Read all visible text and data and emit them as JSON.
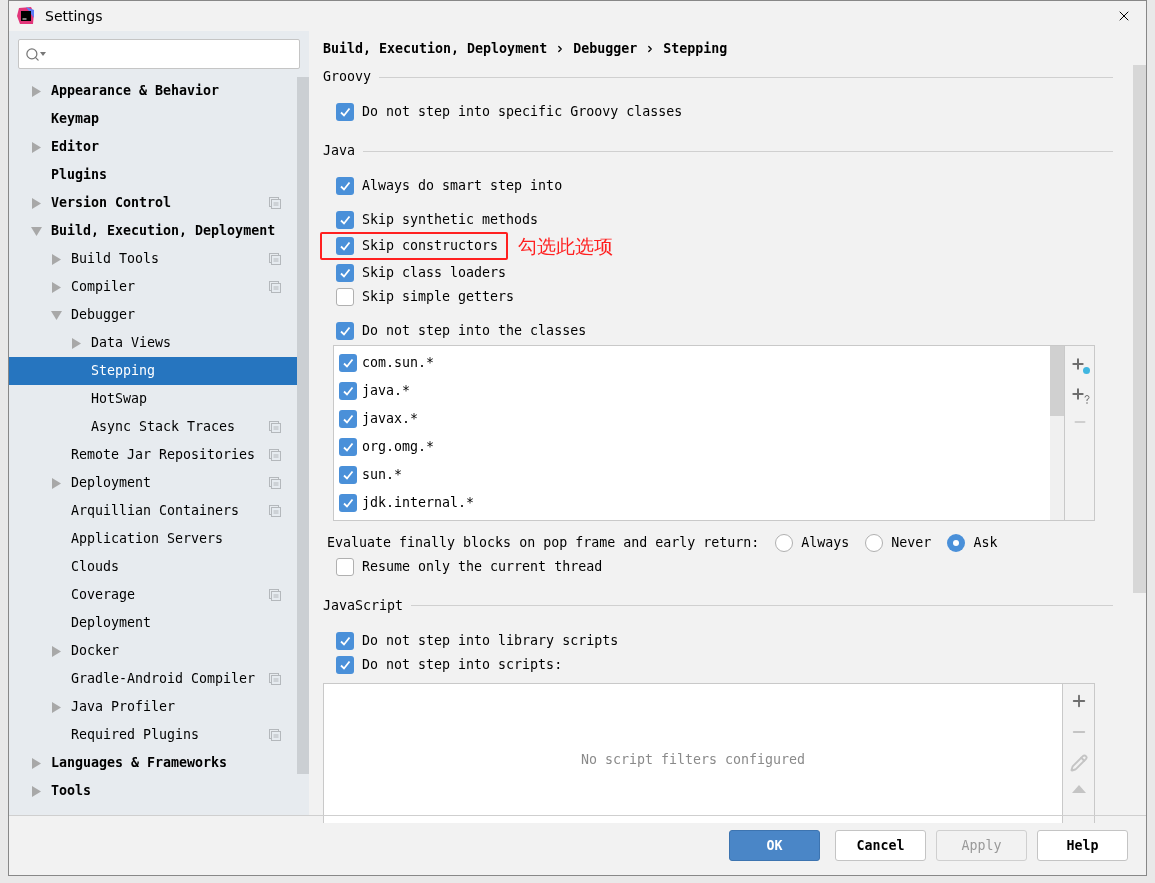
{
  "window": {
    "title": "Settings"
  },
  "sidebar": {
    "items": [
      {
        "label": "Appearance & Behavior",
        "kind": "branch",
        "expanded": false,
        "selected": false,
        "project_level": false
      },
      {
        "label": "Keymap",
        "kind": "leaf",
        "selected": false,
        "project_level": false
      },
      {
        "label": "Editor",
        "kind": "branch",
        "expanded": false,
        "selected": false,
        "project_level": false
      },
      {
        "label": "Plugins",
        "kind": "leaf",
        "selected": false,
        "project_level": false
      },
      {
        "label": "Version Control",
        "kind": "branch",
        "expanded": false,
        "selected": false,
        "project_level": true
      },
      {
        "label": "Build, Execution, Deployment",
        "kind": "branch",
        "expanded": true,
        "selected": false,
        "project_level": false,
        "children": [
          {
            "label": "Build Tools",
            "kind": "branch",
            "expanded": false,
            "selected": false,
            "project_level": true
          },
          {
            "label": "Compiler",
            "kind": "branch",
            "expanded": false,
            "selected": false,
            "project_level": true
          },
          {
            "label": "Debugger",
            "kind": "branch",
            "expanded": true,
            "selected": false,
            "project_level": false,
            "children": [
              {
                "label": "Data Views",
                "kind": "branch",
                "expanded": false,
                "selected": false,
                "project_level": false
              },
              {
                "label": "Stepping",
                "kind": "leaf",
                "selected": true,
                "project_level": false
              },
              {
                "label": "HotSwap",
                "kind": "leaf",
                "selected": false,
                "project_level": false
              },
              {
                "label": "Async Stack Traces",
                "kind": "leaf",
                "selected": false,
                "project_level": true
              }
            ]
          },
          {
            "label": "Remote Jar Repositories",
            "kind": "leaf",
            "selected": false,
            "project_level": true
          },
          {
            "label": "Deployment",
            "kind": "branch",
            "expanded": false,
            "selected": false,
            "project_level": true
          },
          {
            "label": "Arquillian Containers",
            "kind": "leaf",
            "selected": false,
            "project_level": true
          },
          {
            "label": "Application Servers",
            "kind": "leaf",
            "selected": false,
            "project_level": false
          },
          {
            "label": "Clouds",
            "kind": "leaf",
            "selected": false,
            "project_level": false
          },
          {
            "label": "Coverage",
            "kind": "leaf",
            "selected": false,
            "project_level": true
          },
          {
            "label": "Deployment",
            "kind": "leaf",
            "selected": false,
            "project_level": false
          },
          {
            "label": "Docker",
            "kind": "branch",
            "expanded": false,
            "selected": false,
            "project_level": false
          },
          {
            "label": "Gradle-Android Compiler",
            "kind": "leaf",
            "selected": false,
            "project_level": true
          },
          {
            "label": "Java Profiler",
            "kind": "branch",
            "expanded": false,
            "selected": false,
            "project_level": false
          },
          {
            "label": "Required Plugins",
            "kind": "leaf",
            "selected": false,
            "project_level": true
          }
        ]
      },
      {
        "label": "Languages & Frameworks",
        "kind": "branch",
        "expanded": false,
        "selected": false,
        "project_level": false
      },
      {
        "label": "Tools",
        "kind": "branch",
        "expanded": false,
        "selected": false,
        "project_level": false
      }
    ]
  },
  "breadcrumb": [
    "Build, Execution, Deployment",
    "Debugger",
    "Stepping"
  ],
  "sections": [
    {
      "title": "Groovy",
      "groups": [
        [
          {
            "kind": "checkbox",
            "label": "Do not step into specific Groovy classes",
            "checked": true
          }
        ]
      ]
    },
    {
      "title": "Java",
      "groups": [
        [
          {
            "kind": "checkbox",
            "label": "Always do smart step into",
            "checked": true
          }
        ],
        [
          {
            "kind": "checkbox",
            "label": "Skip synthetic methods",
            "checked": true
          },
          {
            "kind": "checkbox",
            "label": "Skip constructors",
            "checked": true,
            "annotation": "勾选此选项"
          },
          {
            "kind": "checkbox",
            "label": "Skip class loaders",
            "checked": true
          },
          {
            "kind": "checkbox",
            "label": "Skip simple getters",
            "checked": false
          }
        ],
        [
          {
            "kind": "checkbox",
            "label": "Do not step into the classes",
            "checked": true
          },
          {
            "kind": "class_list",
            "items": [
              {
                "label": "com.sun.*",
                "checked": true
              },
              {
                "label": "java.*",
                "checked": true
              },
              {
                "label": "javax.*",
                "checked": true
              },
              {
                "label": "org.omg.*",
                "checked": true
              },
              {
                "label": "sun.*",
                "checked": true
              },
              {
                "label": "jdk.internal.*",
                "checked": true
              }
            ]
          }
        ],
        [
          {
            "kind": "radio_group",
            "label": "Evaluate finally blocks on pop frame and early return:",
            "options": [
              {
                "label": "Always",
                "selected": false
              },
              {
                "label": "Never",
                "selected": false
              },
              {
                "label": "Ask",
                "selected": true
              }
            ]
          },
          {
            "kind": "checkbox",
            "label": "Resume only the current thread",
            "checked": false
          }
        ]
      ]
    },
    {
      "title": "JavaScript",
      "groups": [
        [
          {
            "kind": "checkbox",
            "label": "Do not step into library scripts",
            "checked": true
          },
          {
            "kind": "checkbox",
            "label": "Do not step into scripts:",
            "checked": true
          },
          {
            "kind": "filter_list",
            "empty_text": "No script filters configured"
          }
        ]
      ]
    }
  ],
  "buttons": [
    {
      "label": "OK",
      "kind": "primary",
      "disabled": false
    },
    {
      "label": "Cancel",
      "kind": "normal",
      "disabled": false
    },
    {
      "label": "Apply",
      "kind": "normal",
      "disabled": true
    },
    {
      "label": "Help",
      "kind": "normal",
      "disabled": false
    }
  ]
}
